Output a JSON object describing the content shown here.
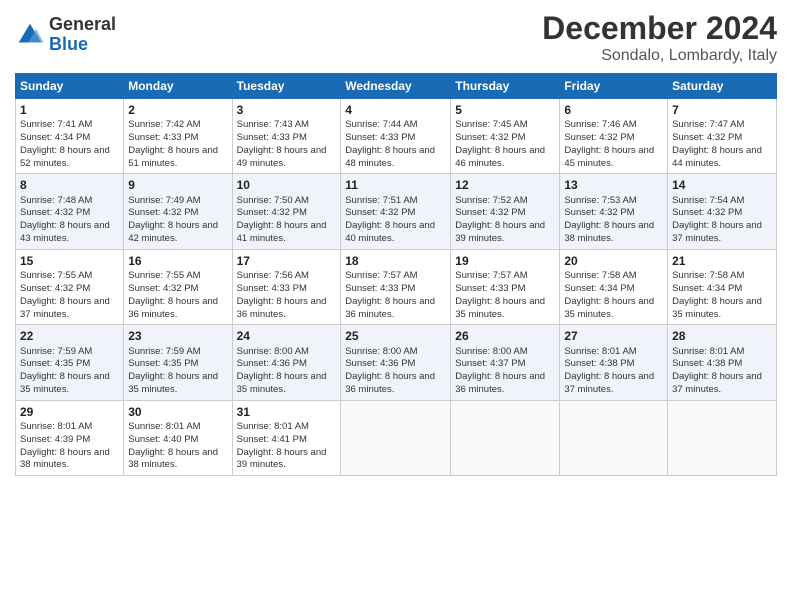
{
  "logo": {
    "line1": "General",
    "line2": "Blue"
  },
  "header": {
    "month": "December 2024",
    "location": "Sondalo, Lombardy, Italy"
  },
  "weekdays": [
    "Sunday",
    "Monday",
    "Tuesday",
    "Wednesday",
    "Thursday",
    "Friday",
    "Saturday"
  ],
  "weeks": [
    [
      {
        "day": "1",
        "sunrise": "Sunrise: 7:41 AM",
        "sunset": "Sunset: 4:34 PM",
        "daylight": "Daylight: 8 hours and 52 minutes."
      },
      {
        "day": "2",
        "sunrise": "Sunrise: 7:42 AM",
        "sunset": "Sunset: 4:33 PM",
        "daylight": "Daylight: 8 hours and 51 minutes."
      },
      {
        "day": "3",
        "sunrise": "Sunrise: 7:43 AM",
        "sunset": "Sunset: 4:33 PM",
        "daylight": "Daylight: 8 hours and 49 minutes."
      },
      {
        "day": "4",
        "sunrise": "Sunrise: 7:44 AM",
        "sunset": "Sunset: 4:33 PM",
        "daylight": "Daylight: 8 hours and 48 minutes."
      },
      {
        "day": "5",
        "sunrise": "Sunrise: 7:45 AM",
        "sunset": "Sunset: 4:32 PM",
        "daylight": "Daylight: 8 hours and 46 minutes."
      },
      {
        "day": "6",
        "sunrise": "Sunrise: 7:46 AM",
        "sunset": "Sunset: 4:32 PM",
        "daylight": "Daylight: 8 hours and 45 minutes."
      },
      {
        "day": "7",
        "sunrise": "Sunrise: 7:47 AM",
        "sunset": "Sunset: 4:32 PM",
        "daylight": "Daylight: 8 hours and 44 minutes."
      }
    ],
    [
      {
        "day": "8",
        "sunrise": "Sunrise: 7:48 AM",
        "sunset": "Sunset: 4:32 PM",
        "daylight": "Daylight: 8 hours and 43 minutes."
      },
      {
        "day": "9",
        "sunrise": "Sunrise: 7:49 AM",
        "sunset": "Sunset: 4:32 PM",
        "daylight": "Daylight: 8 hours and 42 minutes."
      },
      {
        "day": "10",
        "sunrise": "Sunrise: 7:50 AM",
        "sunset": "Sunset: 4:32 PM",
        "daylight": "Daylight: 8 hours and 41 minutes."
      },
      {
        "day": "11",
        "sunrise": "Sunrise: 7:51 AM",
        "sunset": "Sunset: 4:32 PM",
        "daylight": "Daylight: 8 hours and 40 minutes."
      },
      {
        "day": "12",
        "sunrise": "Sunrise: 7:52 AM",
        "sunset": "Sunset: 4:32 PM",
        "daylight": "Daylight: 8 hours and 39 minutes."
      },
      {
        "day": "13",
        "sunrise": "Sunrise: 7:53 AM",
        "sunset": "Sunset: 4:32 PM",
        "daylight": "Daylight: 8 hours and 38 minutes."
      },
      {
        "day": "14",
        "sunrise": "Sunrise: 7:54 AM",
        "sunset": "Sunset: 4:32 PM",
        "daylight": "Daylight: 8 hours and 37 minutes."
      }
    ],
    [
      {
        "day": "15",
        "sunrise": "Sunrise: 7:55 AM",
        "sunset": "Sunset: 4:32 PM",
        "daylight": "Daylight: 8 hours and 37 minutes."
      },
      {
        "day": "16",
        "sunrise": "Sunrise: 7:55 AM",
        "sunset": "Sunset: 4:32 PM",
        "daylight": "Daylight: 8 hours and 36 minutes."
      },
      {
        "day": "17",
        "sunrise": "Sunrise: 7:56 AM",
        "sunset": "Sunset: 4:33 PM",
        "daylight": "Daylight: 8 hours and 36 minutes."
      },
      {
        "day": "18",
        "sunrise": "Sunrise: 7:57 AM",
        "sunset": "Sunset: 4:33 PM",
        "daylight": "Daylight: 8 hours and 36 minutes."
      },
      {
        "day": "19",
        "sunrise": "Sunrise: 7:57 AM",
        "sunset": "Sunset: 4:33 PM",
        "daylight": "Daylight: 8 hours and 35 minutes."
      },
      {
        "day": "20",
        "sunrise": "Sunrise: 7:58 AM",
        "sunset": "Sunset: 4:34 PM",
        "daylight": "Daylight: 8 hours and 35 minutes."
      },
      {
        "day": "21",
        "sunrise": "Sunrise: 7:58 AM",
        "sunset": "Sunset: 4:34 PM",
        "daylight": "Daylight: 8 hours and 35 minutes."
      }
    ],
    [
      {
        "day": "22",
        "sunrise": "Sunrise: 7:59 AM",
        "sunset": "Sunset: 4:35 PM",
        "daylight": "Daylight: 8 hours and 35 minutes."
      },
      {
        "day": "23",
        "sunrise": "Sunrise: 7:59 AM",
        "sunset": "Sunset: 4:35 PM",
        "daylight": "Daylight: 8 hours and 35 minutes."
      },
      {
        "day": "24",
        "sunrise": "Sunrise: 8:00 AM",
        "sunset": "Sunset: 4:36 PM",
        "daylight": "Daylight: 8 hours and 35 minutes."
      },
      {
        "day": "25",
        "sunrise": "Sunrise: 8:00 AM",
        "sunset": "Sunset: 4:36 PM",
        "daylight": "Daylight: 8 hours and 36 minutes."
      },
      {
        "day": "26",
        "sunrise": "Sunrise: 8:00 AM",
        "sunset": "Sunset: 4:37 PM",
        "daylight": "Daylight: 8 hours and 36 minutes."
      },
      {
        "day": "27",
        "sunrise": "Sunrise: 8:01 AM",
        "sunset": "Sunset: 4:38 PM",
        "daylight": "Daylight: 8 hours and 37 minutes."
      },
      {
        "day": "28",
        "sunrise": "Sunrise: 8:01 AM",
        "sunset": "Sunset: 4:38 PM",
        "daylight": "Daylight: 8 hours and 37 minutes."
      }
    ],
    [
      {
        "day": "29",
        "sunrise": "Sunrise: 8:01 AM",
        "sunset": "Sunset: 4:39 PM",
        "daylight": "Daylight: 8 hours and 38 minutes."
      },
      {
        "day": "30",
        "sunrise": "Sunrise: 8:01 AM",
        "sunset": "Sunset: 4:40 PM",
        "daylight": "Daylight: 8 hours and 38 minutes."
      },
      {
        "day": "31",
        "sunrise": "Sunrise: 8:01 AM",
        "sunset": "Sunset: 4:41 PM",
        "daylight": "Daylight: 8 hours and 39 minutes."
      },
      null,
      null,
      null,
      null
    ]
  ]
}
